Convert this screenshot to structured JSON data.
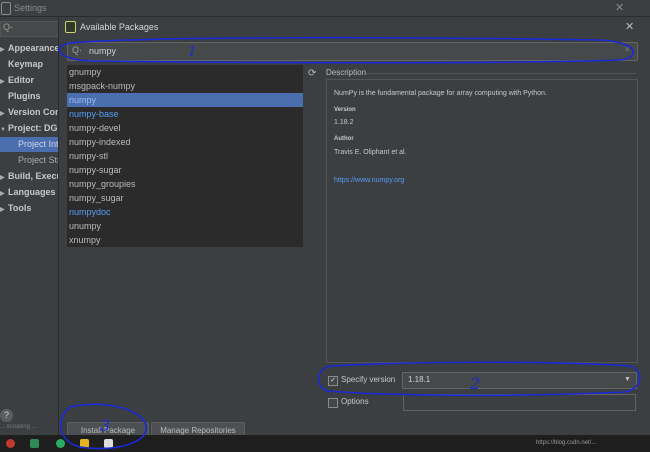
{
  "background_window": {
    "title": "Settings",
    "sidebar_search_placeholder": "Q-",
    "sidebar_items": [
      {
        "label": "Appearance &",
        "expanded": false
      },
      {
        "label": "Keymap"
      },
      {
        "label": "Editor",
        "expanded": false
      },
      {
        "label": "Plugins"
      },
      {
        "label": "Version Cont",
        "expanded": false
      },
      {
        "label": "Project: DGN",
        "expanded": true
      },
      {
        "label": "Project Inte",
        "selected": true
      },
      {
        "label": "Project Stru"
      },
      {
        "label": "Build, Execut",
        "expanded": false
      },
      {
        "label": "Languages &",
        "expanded": false
      },
      {
        "label": "Tools",
        "expanded": false
      }
    ],
    "help_label": "?",
    "status_fragment": "... installing ..."
  },
  "dialog": {
    "title": "Available Packages",
    "close": "✕",
    "search": {
      "value": "numpy"
    },
    "packages": [
      {
        "name": "gnumpy",
        "installed": false
      },
      {
        "name": "msgpack-numpy",
        "installed": false
      },
      {
        "name": "numpy",
        "installed": true,
        "selected": true
      },
      {
        "name": "numpy-base",
        "installed": true
      },
      {
        "name": "numpy-devel",
        "installed": false
      },
      {
        "name": "numpy-indexed",
        "installed": false
      },
      {
        "name": "numpy-stl",
        "installed": false
      },
      {
        "name": "numpy-sugar",
        "installed": false
      },
      {
        "name": "numpy_groupies",
        "installed": false
      },
      {
        "name": "numpy_sugar",
        "installed": false
      },
      {
        "name": "numpydoc",
        "installed": true
      },
      {
        "name": "unumpy",
        "installed": false
      },
      {
        "name": "xnumpy",
        "installed": false
      }
    ],
    "description": {
      "label": "Description",
      "summary": "NumPy is the fundamental package for array computing with Python.",
      "version_heading": "Version",
      "version": "1.18.2",
      "author_heading": "Author",
      "author": "Travis E. Oliphant et al.",
      "url": "https://www.numpy.org"
    },
    "specify_version": {
      "label": "Specify version",
      "checked": true,
      "value": "1.18.1"
    },
    "options": {
      "label": "Options",
      "checked": false,
      "value": ""
    },
    "buttons": {
      "install": "Install Package",
      "manage": "Manage Repositories"
    }
  },
  "taskbar": {
    "url_text": "https://blog.csdn.net/..."
  },
  "annotations": [
    "1",
    "2",
    "3"
  ],
  "colors": {
    "accent": "#4b6eaf",
    "installed_text": "#589df6",
    "ink": "#1a2ad6"
  }
}
